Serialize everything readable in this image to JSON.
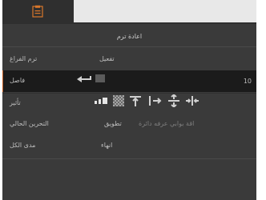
{
  "header": {
    "title": "اعادة ترم"
  },
  "rows": {
    "row1": {
      "label": "ترم الفراغ",
      "value": "تفعيل"
    },
    "row2": {
      "label": "فاصل",
      "value": "10"
    },
    "row3": {
      "label": "تأثير"
    },
    "row4": {
      "label": "التحرين الحالي",
      "value": "تطويق",
      "disabled_value": "اقة بوابي عرفه دائرة"
    },
    "row5": {
      "label": "مدى الكل",
      "value": "انهاء"
    }
  },
  "icons": {
    "app": "clipboard-icon",
    "enter": "enter-icon",
    "square": "stop-icon",
    "effects": [
      "bars-icon",
      "checker-icon",
      "align-top-icon",
      "align-right-icon",
      "align-center-icon",
      "align-split-icon"
    ]
  },
  "colors": {
    "panel_bg": "#3a3a3a",
    "highlight_bg": "#1b1b1b",
    "accent": "#c15a1d"
  }
}
